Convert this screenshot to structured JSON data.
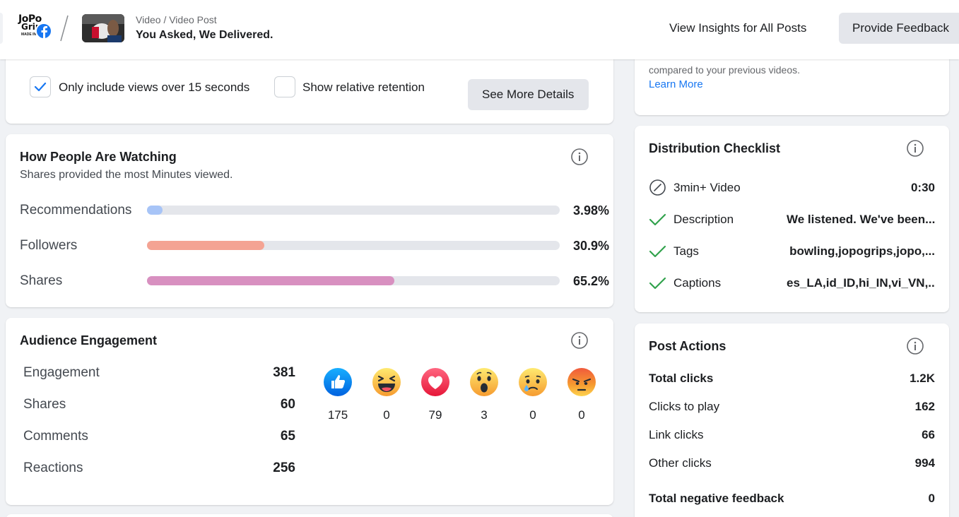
{
  "header": {
    "brand_line1": "JoPo",
    "brand_line2": "Grip",
    "brand_line3": "MADE IN",
    "breadcrumb": "Video / Video Post",
    "post_title": "You Asked, We Delivered.",
    "view_insights_label": "View Insights for All Posts",
    "feedback_label": "Provide Feedback"
  },
  "retention": {
    "only_15s_label": "Only include views over 15 seconds",
    "only_15s_checked": true,
    "relative_label": "Show relative retention",
    "relative_checked": false,
    "see_more_label": "See More Details"
  },
  "performance_note": {
    "text": "compared to your previous videos.",
    "learn_more": "Learn More"
  },
  "watching": {
    "title": "How People Are Watching",
    "subtitle": "Shares provided the most Minutes viewed.",
    "sources": [
      {
        "label": "Recommendations",
        "pct_text": "3.98%",
        "fraction": 0.0398,
        "color": "#a7c4f7"
      },
      {
        "label": "Followers",
        "pct_text": "30.9%",
        "fraction": 0.309,
        "color": "#f4a393"
      },
      {
        "label": "Shares",
        "pct_text": "65.2%",
        "fraction": 0.652,
        "color": "#d890c0"
      }
    ]
  },
  "engagement": {
    "title": "Audience Engagement",
    "rows": [
      {
        "label": "Engagement",
        "value": "381"
      },
      {
        "label": "Shares",
        "value": "60"
      },
      {
        "label": "Comments",
        "value": "65"
      },
      {
        "label": "Reactions",
        "value": "256"
      }
    ],
    "reactions": [
      {
        "name": "like-icon",
        "count": "175"
      },
      {
        "name": "haha-icon",
        "count": "0"
      },
      {
        "name": "love-icon",
        "count": "79"
      },
      {
        "name": "wow-icon",
        "count": "3"
      },
      {
        "name": "sad-icon",
        "count": "0"
      },
      {
        "name": "angry-icon",
        "count": "0"
      }
    ]
  },
  "checklist": {
    "title": "Distribution Checklist",
    "items": [
      {
        "label": "3min+ Video",
        "value": "0:30",
        "status": "not-met"
      },
      {
        "label": "Description",
        "value": "We listened. We've been...",
        "status": "met"
      },
      {
        "label": "Tags",
        "value": "bowling,jopogrips,jopo,...",
        "status": "met"
      },
      {
        "label": "Captions",
        "value": "es_LA,id_ID,hi_IN,vi_VN,...",
        "status": "met"
      }
    ]
  },
  "post_actions": {
    "title": "Post Actions",
    "rows": [
      {
        "label": "Total clicks",
        "value": "1.2K",
        "bold": true
      },
      {
        "label": "Clicks to play",
        "value": "162",
        "bold": false
      },
      {
        "label": "Link clicks",
        "value": "66",
        "bold": false
      },
      {
        "label": "Other clicks",
        "value": "994",
        "bold": false
      },
      {
        "label": "Total negative feedback",
        "value": "0",
        "bold": true
      }
    ]
  },
  "colors": {
    "accent": "#1877f2",
    "check_green": "#31a24c",
    "background": "#f0f2f5"
  }
}
